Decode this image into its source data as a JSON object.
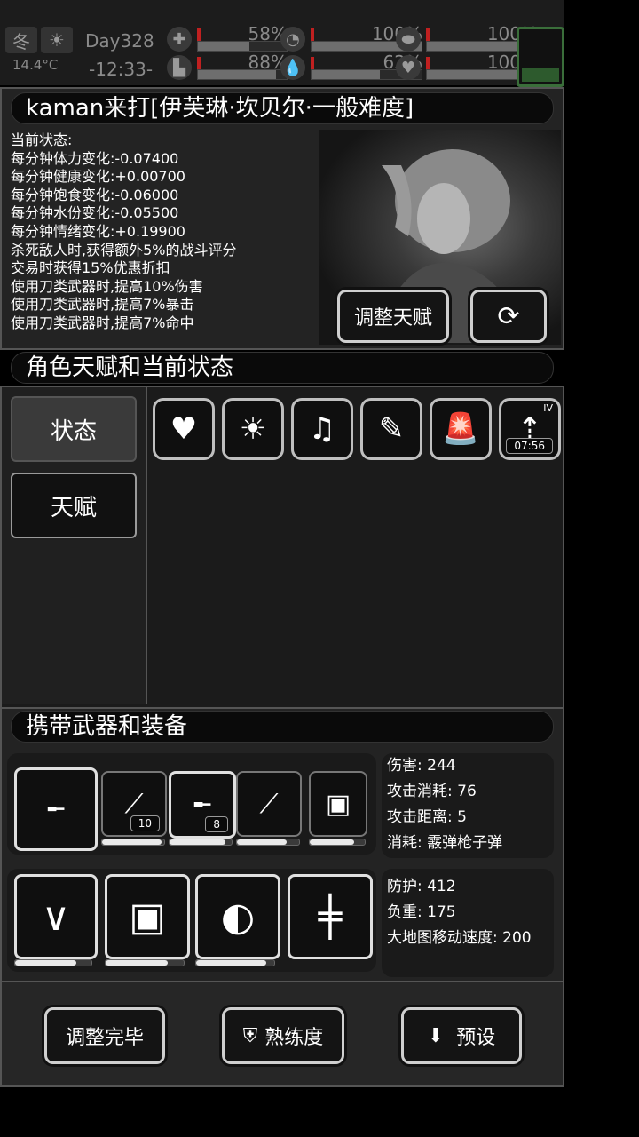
{
  "topbar": {
    "season": "冬",
    "temperature": "14.4°C",
    "day": "Day328",
    "time": "-12:33-",
    "stats": [
      {
        "icon": "medkit-icon",
        "glyph": "✚",
        "percent": "58%",
        "value": 0.58
      },
      {
        "icon": "stomach-icon",
        "glyph": "◔",
        "percent": "100%",
        "value": 1.0
      },
      {
        "icon": "bladder-icon",
        "glyph": "⬬",
        "percent": "100%",
        "value": 1.0
      },
      {
        "icon": "boot-icon",
        "glyph": "▙",
        "percent": "88%",
        "value": 0.88
      },
      {
        "icon": "water-drop-icon",
        "glyph": "💧",
        "percent": "62%",
        "value": 0.62
      },
      {
        "icon": "heart-icon",
        "glyph": "♥",
        "percent": "100%",
        "value": 1.0
      }
    ],
    "battery": 0.3
  },
  "character": {
    "title": "kaman来打[伊芙琳·坎贝尔·一般难度]",
    "status_lines": [
      "当前状态:",
      "每分钟体力变化:-0.07400",
      "每分钟健康变化:+0.00700",
      "每分钟饱食变化:-0.06000",
      "每分钟水份变化:-0.05500",
      "每分钟情绪变化:+0.19900",
      "杀死敌人时,获得额外5%的战斗评分",
      "交易时获得15%优惠折扣",
      "使用刀类武器时,提高10%伤害",
      "使用刀类武器时,提高7%暴击",
      "使用刀类武器时,提高7%命中"
    ],
    "adjust_talent_label": "调整天赋"
  },
  "talent_section": {
    "title": "角色天赋和当前状态",
    "tab_status": "状态",
    "tab_talent": "天赋",
    "status_icons": [
      {
        "name": "heart-status-icon",
        "glyph": "♥"
      },
      {
        "name": "sun-status-icon",
        "glyph": "☀"
      },
      {
        "name": "mood-music-icon",
        "glyph": "♫"
      },
      {
        "name": "medicine-icon",
        "glyph": "✎"
      },
      {
        "name": "alarm-light-icon",
        "glyph": "🚨"
      },
      {
        "name": "alcohol-buff-icon",
        "glyph": "⇡",
        "timer": "07:56",
        "level": "IV"
      }
    ]
  },
  "equipment": {
    "title": "携带武器和装备",
    "weapons": [
      {
        "name": "shotgun-icon",
        "glyph": "╾",
        "durability": 0.0
      },
      {
        "name": "rifle-icon",
        "glyph": "⟋",
        "count": "10",
        "durability": 0.95
      },
      {
        "name": "shotgun-secondary-icon",
        "glyph": "╾",
        "count": "8",
        "durability": 0.9
      },
      {
        "name": "shovel-icon",
        "glyph": "⟋",
        "durability": 0.8
      },
      {
        "name": "gadget-icon",
        "glyph": "▣",
        "durability": 0.8
      }
    ],
    "armor": [
      {
        "name": "leg-guards-icon",
        "glyph": "∨",
        "durability": 0.8
      },
      {
        "name": "body-armor-icon",
        "glyph": "▣",
        "durability": 0.8
      },
      {
        "name": "helmet-icon",
        "glyph": "◐",
        "durability": 0.9
      },
      {
        "name": "backpack-frame-icon",
        "glyph": "╪",
        "durability": 0
      }
    ],
    "weapon_stats": [
      "伤害: 244",
      "攻击消耗: 76",
      "攻击距离: 5",
      "消耗: 霰弹枪子弹"
    ],
    "armor_stats": [
      "防护: 412",
      "负重: 175",
      "大地图移动速度: 200"
    ]
  },
  "footer": {
    "done_label": "调整完毕",
    "proficiency_label": "熟练度",
    "preset_label": "预设"
  }
}
